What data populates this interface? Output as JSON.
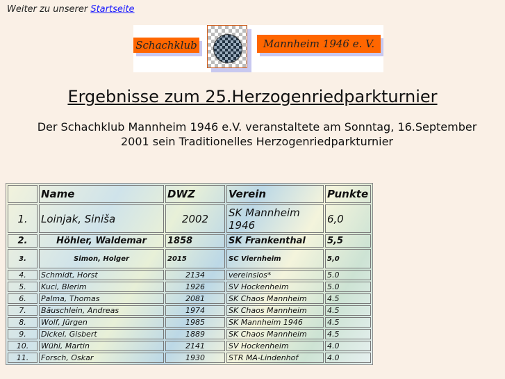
{
  "nav": {
    "prefix": "Weiter zu unserer",
    "link": "Startseite"
  },
  "logo": {
    "left": "Schachklub",
    "right": "Mannheim 1946 e. V."
  },
  "title": "Ergebnisse zum 25.Herzogenriedparkturnier",
  "subtitle_line1": "Der Schachklub Mannheim 1946 e.V. veranstaltete  am Sonntag, 16.September",
  "subtitle_line2": "2001 sein Traditionelles  Herzogenriedparkturnier",
  "table": {
    "headers": [
      "",
      "Name",
      "DWZ",
      "Verein",
      "Punkte"
    ],
    "rows": [
      [
        "1.",
        "Loinjak, Siniša",
        "2002",
        "SK Mannheim 1946",
        "6,0"
      ],
      [
        "2.",
        "Höhler, Waldemar",
        "1858",
        "SK Frankenthal",
        "5,5"
      ],
      [
        "3.",
        "Simon, Holger",
        "2015",
        "SC Viernheim",
        "5,0"
      ],
      [
        "4.",
        "Schmidt, Horst",
        "2134",
        "vereinslos*",
        "5.0"
      ],
      [
        "5.",
        "Kuci, Blerim",
        "1926",
        "SV Hockenheim",
        "5.0"
      ],
      [
        "6.",
        "Palma, Thomas",
        "2081",
        "SK Chaos Mannheim",
        "4.5"
      ],
      [
        "7.",
        "Bäuschlein, Andreas",
        "1974",
        "SK Chaos Mannheim",
        "4.5"
      ],
      [
        "8.",
        "Wolf, Jürgen",
        "1985",
        "SK Mannheim 1946",
        "4.5"
      ],
      [
        "9.",
        "Dickel, Gisbert",
        "1889",
        "SK Chaos Mannheim",
        "4.5"
      ],
      [
        "10.",
        "Wühl, Martin",
        "2141",
        "SV Hockenheim",
        "4.0"
      ],
      [
        "11.",
        "Forsch, Oskar",
        "1930",
        "STR MA-Lindenhof",
        "4.0"
      ]
    ]
  }
}
